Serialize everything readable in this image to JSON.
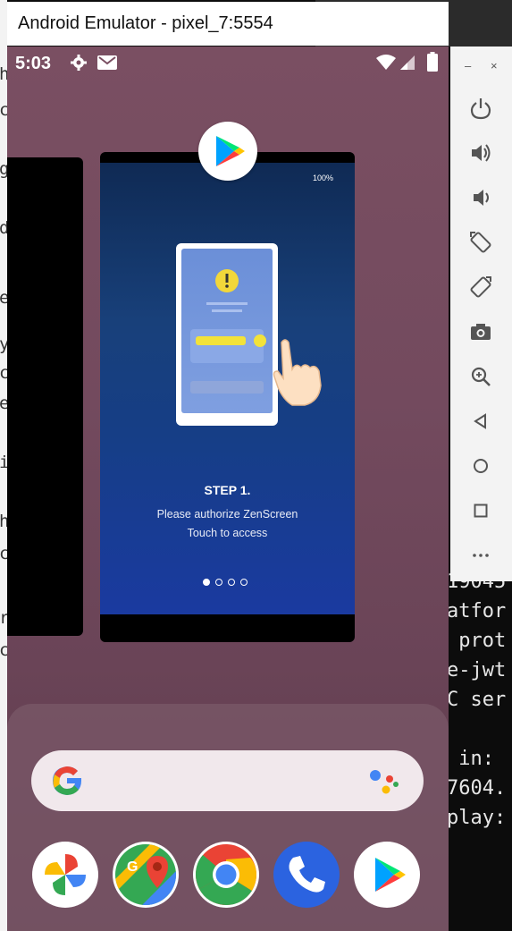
{
  "window": {
    "title": "Android Emulator - pixel_7:5554"
  },
  "status_bar": {
    "time": "5:03"
  },
  "recent_card": {
    "status_text": "100%",
    "step_title": "STEP 1.",
    "line1": "Please authorize ZenScreen",
    "line2": "Touch to access",
    "pager_total": 4,
    "pager_active": 1
  },
  "terminal_right_lines": [
    "19045",
    "atfor",
    " prot",
    "e-jwt",
    "C ser",
    "",
    " in:",
    "7604.",
    "play:"
  ],
  "terminal_left_chars": [
    "h",
    "c",
    "g",
    "",
    "",
    "d",
    "e",
    "y",
    "",
    "",
    "c",
    "e",
    "",
    "",
    "i",
    "h",
    "c",
    "",
    "r",
    "",
    "c"
  ],
  "dock": {
    "apps": [
      "Photos",
      "Maps",
      "Chrome",
      "Phone",
      "Play Store"
    ]
  },
  "toolbar": {
    "buttons": [
      "power",
      "volume-up",
      "volume-down",
      "rotate-left",
      "rotate-right",
      "screenshot",
      "zoom",
      "back",
      "home",
      "overview",
      "more"
    ]
  },
  "colors": {
    "accent_blue": "#1a3aa0",
    "wallpaper": "#734a5e"
  }
}
